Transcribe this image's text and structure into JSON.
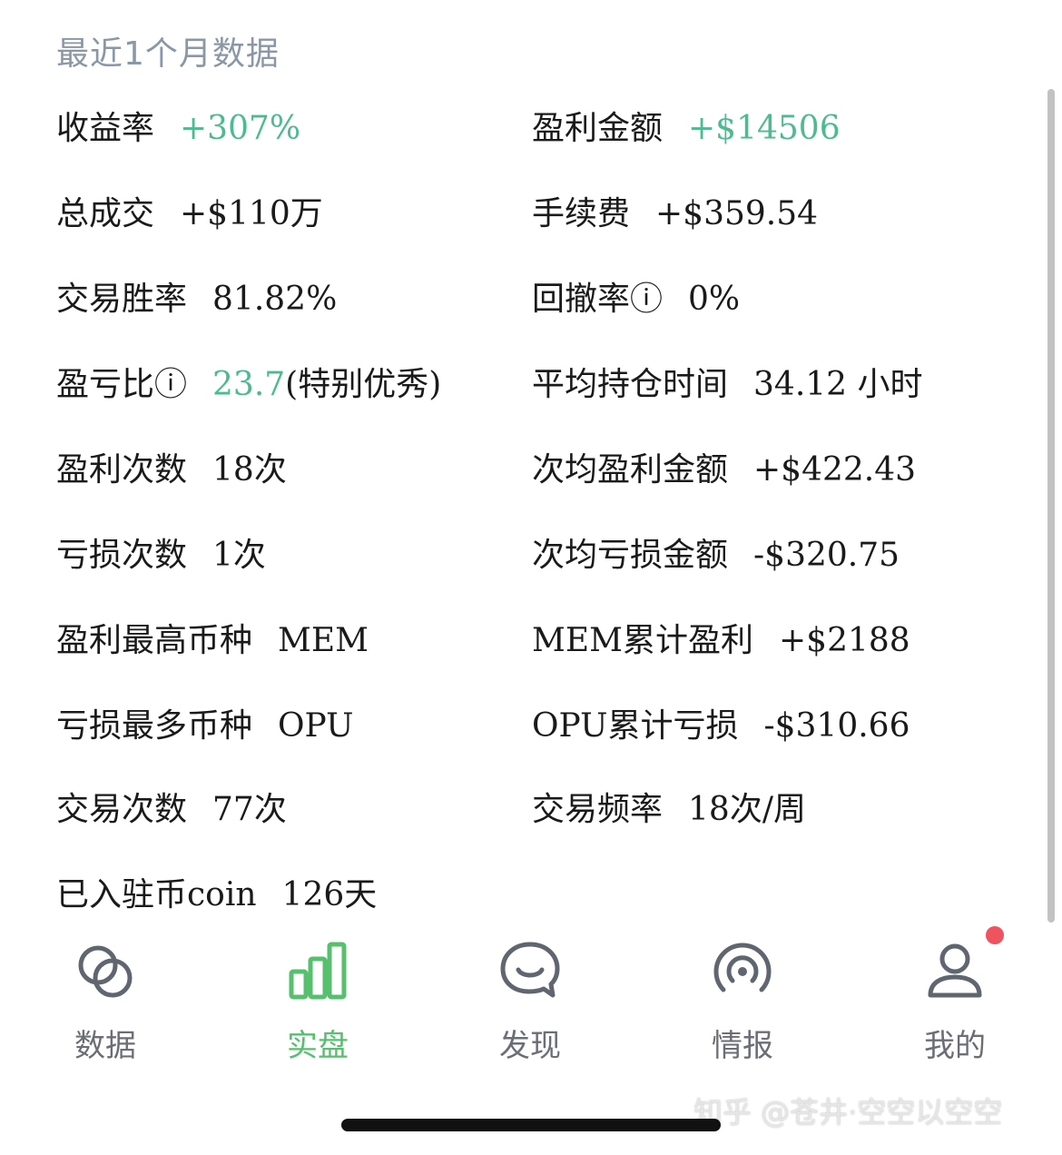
{
  "section_title": "最近1个月数据",
  "stats": [
    {
      "label": "收益率",
      "value": "+307%"
    },
    {
      "label": "盈利金额",
      "value": "+$14506"
    },
    {
      "label": "总成交",
      "value": "+$110万"
    },
    {
      "label": "手续费",
      "value": "+$359.54"
    },
    {
      "label": "交易胜率",
      "value": "81.82%"
    },
    {
      "label": "回撤率ⓘ",
      "value": "0%"
    },
    {
      "label": "盈亏比ⓘ",
      "value": "23.7",
      "note": "(特别优秀)"
    },
    {
      "label": "平均持仓时间",
      "value": "34.12 小时"
    },
    {
      "label": "盈利次数",
      "value": "18次"
    },
    {
      "label": "次均盈利金额",
      "value": "+$422.43"
    },
    {
      "label": "亏损次数",
      "value": "1次"
    },
    {
      "label": "次均亏损金额",
      "value": "-$320.75"
    },
    {
      "label": "盈利最高币种",
      "value": "MEM"
    },
    {
      "label": "MEM累计盈利",
      "value": "+$2188"
    },
    {
      "label": "亏损最多币种",
      "value": "OPU"
    },
    {
      "label": "OPU累计亏损",
      "value": "-$310.66"
    },
    {
      "label": "交易次数",
      "value": "77次"
    },
    {
      "label": "交易频率",
      "value": "18次/周"
    },
    {
      "label": "已入驻币coin",
      "value": "126天"
    }
  ],
  "tabs": [
    {
      "label": "数据",
      "icon": "circles-icon"
    },
    {
      "label": "实盘",
      "icon": "bar-chart-icon"
    },
    {
      "label": "发现",
      "icon": "chat-bubble-icon"
    },
    {
      "label": "情报",
      "icon": "broadcast-icon"
    },
    {
      "label": "我的",
      "icon": "user-icon"
    }
  ],
  "active_tab": "实盘",
  "watermark": "知乎 @苍井·空空以空空",
  "colors": {
    "positive": "#4dbb90",
    "active_tab": "#56c06e",
    "inactive_tab": "#6b6f75",
    "title": "#8a97a6",
    "badge": "#ef5360"
  }
}
